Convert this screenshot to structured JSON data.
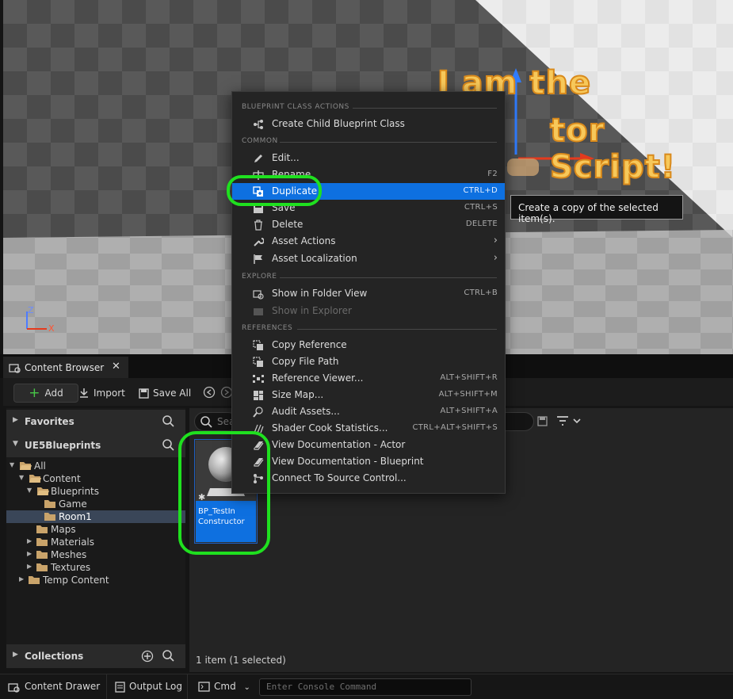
{
  "viewport": {
    "line1": "I am the",
    "line2": "tor Script!",
    "axis_x": "X",
    "axis_z": "Z"
  },
  "menu": {
    "sections": {
      "blueprint": "BLUEPRINT CLASS ACTIONS",
      "common": "COMMON",
      "explore": "EXPLORE",
      "references": "REFERENCES"
    },
    "items": {
      "create_child": {
        "label": "Create Child Blueprint Class"
      },
      "edit": {
        "label": "Edit..."
      },
      "rename": {
        "label": "Rename",
        "shortcut": "F2"
      },
      "duplicate": {
        "label": "Duplicate",
        "shortcut": "CTRL+D"
      },
      "save": {
        "label": "Save",
        "shortcut": "CTRL+S"
      },
      "delete": {
        "label": "Delete",
        "shortcut": "DELETE"
      },
      "asset_actions": {
        "label": "Asset Actions"
      },
      "asset_localization": {
        "label": "Asset Localization"
      },
      "show_folder": {
        "label": "Show in Folder View",
        "shortcut": "CTRL+B"
      },
      "show_explorer": {
        "label": "Show in Explorer"
      },
      "copy_reference": {
        "label": "Copy Reference"
      },
      "copy_path": {
        "label": "Copy File Path"
      },
      "ref_viewer": {
        "label": "Reference Viewer...",
        "shortcut": "ALT+SHIFT+R"
      },
      "size_map": {
        "label": "Size Map...",
        "shortcut": "ALT+SHIFT+M"
      },
      "audit": {
        "label": "Audit Assets...",
        "shortcut": "ALT+SHIFT+A"
      },
      "shader_cook": {
        "label": "Shader Cook Statistics...",
        "shortcut": "CTRL+ALT+SHIFT+S"
      },
      "doc_actor": {
        "label": "View Documentation - Actor"
      },
      "doc_blueprint": {
        "label": "View Documentation - Blueprint"
      },
      "source_control": {
        "label": "Connect To Source Control..."
      }
    }
  },
  "tooltip": "Create a copy of the selected item(s).",
  "content_browser": {
    "tab_label": "Content Browser",
    "toolbar": {
      "add": "Add",
      "import": "Import",
      "save_all": "Save All"
    },
    "favorites": "Favorites",
    "project": "UE5Blueprints",
    "collections": "Collections",
    "search_placeholder": "Sea",
    "tree": {
      "all": "All",
      "content": "Content",
      "blueprints": "Blueprints",
      "game": "Game",
      "room1": "Room1",
      "maps": "Maps",
      "materials": "Materials",
      "meshes": "Meshes",
      "textures": "Textures",
      "temp": "Temp Content"
    },
    "asset_name": "BP_TestIn Constructor",
    "item_count": "1 item (1 selected)"
  },
  "status_bar": {
    "drawer": "Content Drawer",
    "output_log": "Output Log",
    "cmd": "Cmd",
    "console_placeholder": "Enter Console Command"
  },
  "colors": {
    "highlight": "#1fe01f",
    "selection": "#0e70e0",
    "text_outline": "#d98a1c"
  }
}
